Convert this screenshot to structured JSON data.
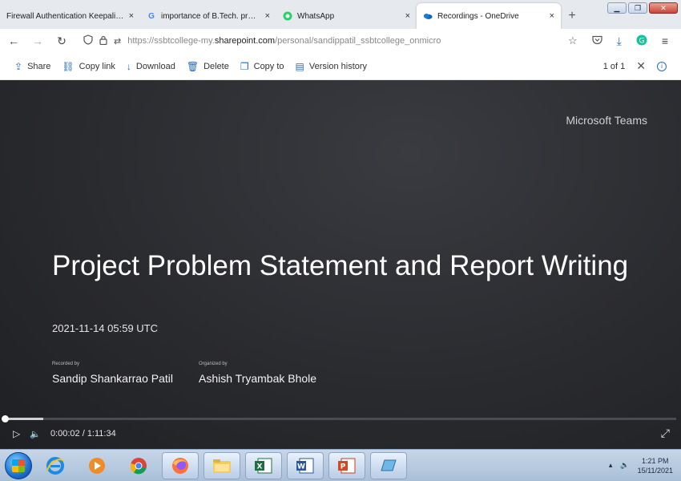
{
  "browser": {
    "tabs": [
      {
        "title": "Firewall Authentication Keepalive",
        "favicon": "",
        "active": false
      },
      {
        "title": "importance of B.Tech. project",
        "favicon": "G",
        "active": false
      },
      {
        "title": "WhatsApp",
        "favicon": "whatsapp-icon",
        "active": false
      },
      {
        "title": "Recordings - OneDrive",
        "favicon": "onedrive-icon",
        "active": true
      }
    ],
    "tab_close_glyph": "×",
    "new_tab_glyph": "+",
    "url_prefix": "https://ssbtcollege-my.",
    "url_domain": "sharepoint.com",
    "url_path": "/personal/sandippatil_ssbtcollege_onmicro"
  },
  "commandbar": {
    "items": [
      {
        "label": "Share",
        "icon": "share-icon"
      },
      {
        "label": "Copy link",
        "icon": "link-icon"
      },
      {
        "label": "Download",
        "icon": "download-icon"
      },
      {
        "label": "Delete",
        "icon": "trash-icon"
      },
      {
        "label": "Copy to",
        "icon": "copy-icon"
      },
      {
        "label": "Version history",
        "icon": "history-icon"
      }
    ],
    "page_count": "1 of 1"
  },
  "video": {
    "brand": "Microsoft Teams",
    "title": "Project Problem Statement and Report Writing",
    "date": "2021-11-14 05:59 UTC",
    "recorded_by_label": "Recorded by",
    "recorded_by": "Sandip Shankarrao Patil",
    "organized_by_label": "Organized by",
    "organized_by": "Ashish Tryambak Bhole",
    "current_time": "0:00:02",
    "duration": "1:11:34",
    "progress": 0.0005
  },
  "taskbar": {
    "time": "1:21 PM",
    "date": "15/11/2021"
  }
}
